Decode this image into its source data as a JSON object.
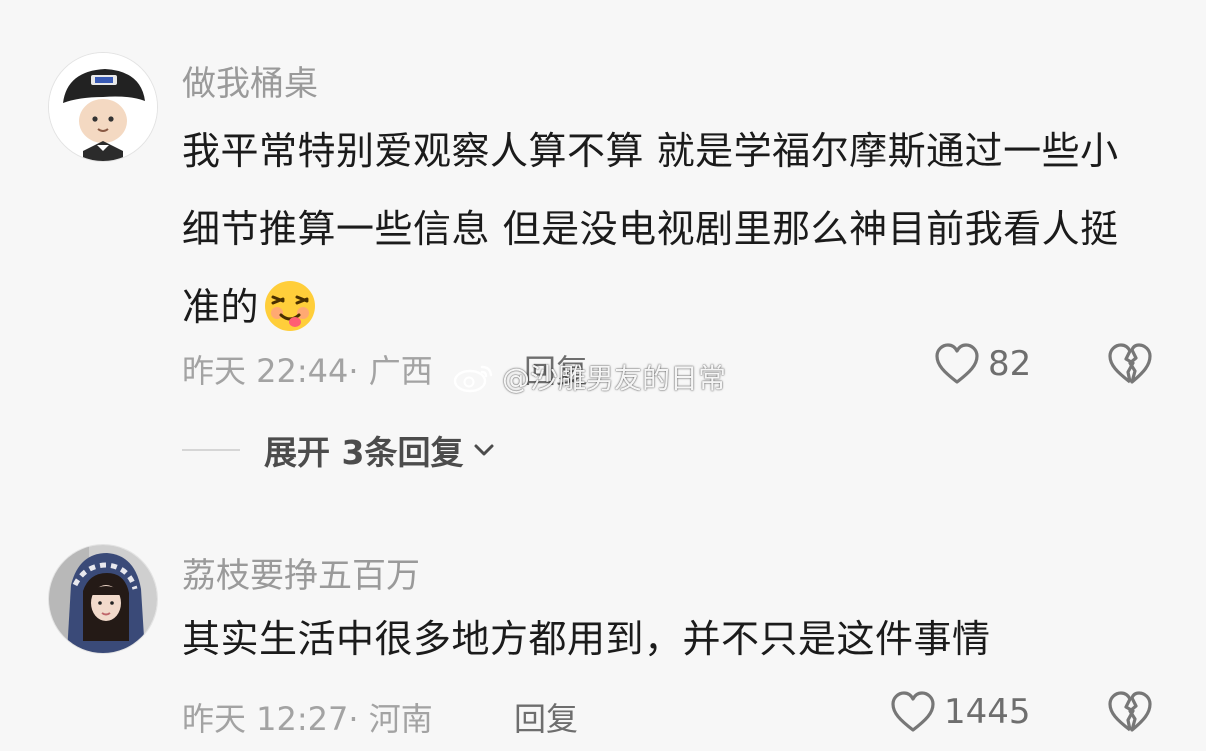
{
  "comments": [
    {
      "username": "做我桶桌",
      "text": "我平常特别爱观察人算不算 就是学福尔摩斯通过一些小细节推算一些信息 但是没电视剧里那么神目前我看人挺准的",
      "emoji": "drunk-face-emoji",
      "time": "昨天 22:44",
      "location": "· 广西",
      "reply_label": "回复",
      "likes": "82",
      "expand_label": "展开 3条回复"
    },
    {
      "username": "荔枝要挣五百万",
      "text": "其实生活中很多地方都用到，并不只是这件事情",
      "time": "昨天 12:27",
      "location": "· 河南",
      "reply_label": "回复",
      "likes": "1445"
    }
  ],
  "watermark": {
    "text": "@沙雕男友的日常",
    "icon": "weibo-logo-icon"
  },
  "colors": {
    "background": "#f7f7f7",
    "username": "#9a9a9a",
    "meta": "#a3a3a3",
    "text": "#1b1b1b"
  }
}
